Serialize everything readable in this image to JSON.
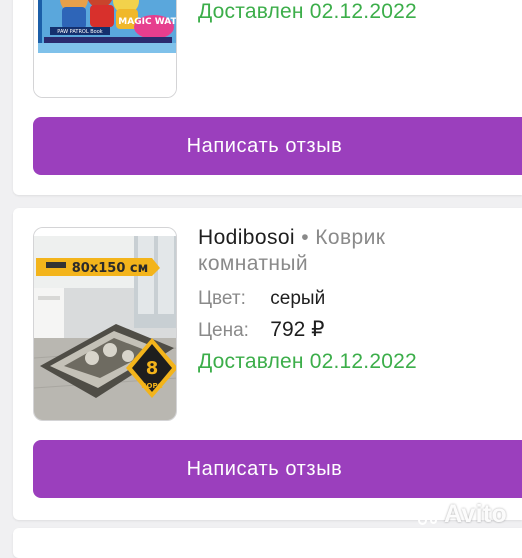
{
  "orders": [
    {
      "thumb": {
        "logo_text": "MAGIC WATER",
        "caption": "PAW PATROL  Book"
      },
      "delivered_text": "Доставлен 02.12.2022",
      "button_label": "Написать отзыв"
    },
    {
      "brand": "Hodibosoi",
      "separator": "•",
      "product": "Коврик комнатный",
      "color": {
        "label": "Цвет:",
        "value": "серый"
      },
      "price": {
        "label": "Цена:",
        "value": "792 ₽"
      },
      "thumb": {
        "size_badge": "80x150 см",
        "style_badge": "8",
        "style_badge_sub": "ВОРС"
      },
      "delivered_text": "Доставлен 02.12.2022",
      "button_label": "Написать отзыв"
    }
  ],
  "watermark": {
    "text": "Avito"
  },
  "colors": {
    "accent": "#9b3fbd",
    "delivered": "#3cae4a",
    "muted": "#8a8a8a",
    "background": "#f0f0f2"
  }
}
